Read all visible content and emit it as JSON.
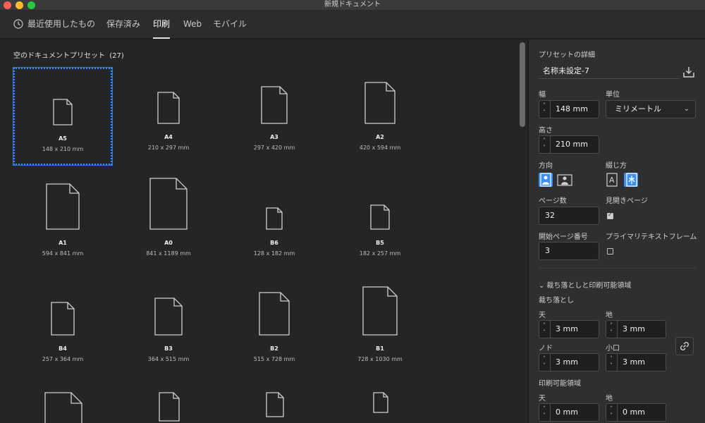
{
  "window": {
    "title": "新規ドキュメント"
  },
  "tabs": [
    {
      "label": "最近使用したもの",
      "icon": "clock-icon"
    },
    {
      "label": "保存済み"
    },
    {
      "label": "印刷"
    },
    {
      "label": "Web"
    },
    {
      "label": "モバイル"
    }
  ],
  "active_tab": "印刷",
  "presets_section": {
    "title": "空のドキュメントプリセット",
    "count": "(27)"
  },
  "presets": [
    {
      "name": "A5",
      "size": "148 x 210 mm"
    },
    {
      "name": "A4",
      "size": "210 x 297 mm"
    },
    {
      "name": "A3",
      "size": "297 x 420 mm"
    },
    {
      "name": "A2",
      "size": "420 x 594 mm"
    },
    {
      "name": "A1",
      "size": "594 x 841 mm"
    },
    {
      "name": "A0",
      "size": "841 x 1189 mm"
    },
    {
      "name": "B6",
      "size": "128 x 182 mm"
    },
    {
      "name": "B5",
      "size": "182 x 257 mm"
    },
    {
      "name": "B4",
      "size": "257 x 364 mm"
    },
    {
      "name": "B3",
      "size": "364 x 515 mm"
    },
    {
      "name": "B2",
      "size": "515 x 728 mm"
    },
    {
      "name": "B1",
      "size": "728 x 1030 mm"
    }
  ],
  "details": {
    "heading": "プリセットの詳細",
    "doc_name": "名称未設定-7",
    "width_label": "幅",
    "width_value": "148 mm",
    "unit_label": "単位",
    "unit_value": "ミリメートル",
    "height_label": "高さ",
    "height_value": "210 mm",
    "orientation_label": "方向",
    "binding_label": "綴じ方",
    "pages_label": "ページ数",
    "pages_value": "32",
    "facing_label": "見開きページ",
    "facing_checked": true,
    "start_label": "開始ページ番号",
    "start_value": "3",
    "primary_frame_label": "プライマリテキストフレーム",
    "primary_frame_checked": false
  },
  "bleed": {
    "section_label": "裁ち落としと印刷可能領域",
    "bleed_label": "裁ち落とし",
    "top_label": "天",
    "top_value": "3 mm",
    "bottom_label": "地",
    "bottom_value": "3 mm",
    "inside_label": "ノド",
    "inside_value": "3 mm",
    "outside_label": "小口",
    "outside_value": "3 mm",
    "slug_label": "印刷可能領域",
    "slug_top_label": "天",
    "slug_top_value": "0 mm",
    "slug_bottom_label": "地",
    "slug_bottom_value": "0 mm"
  },
  "colors": {
    "accent": "#3c8ff0",
    "background": "#252525",
    "panel": "#2f2f2f"
  }
}
